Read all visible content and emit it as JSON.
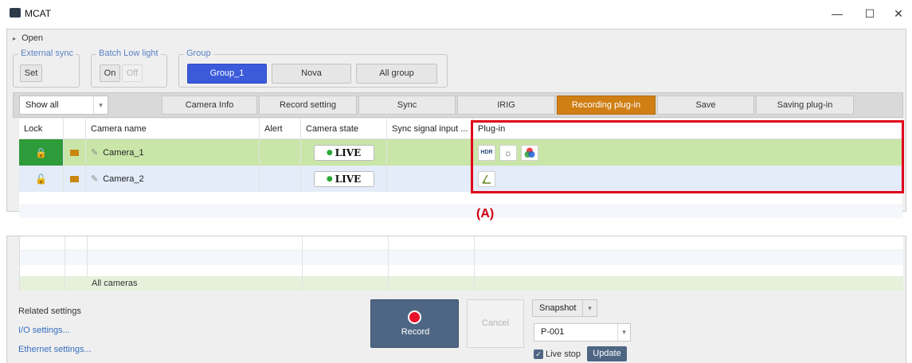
{
  "window": {
    "title": "MCAT",
    "minimize": "—",
    "maximize": "☐",
    "close": "✕"
  },
  "open_label": "Open",
  "groups": {
    "external_sync": {
      "legend": "External sync",
      "set": "Set"
    },
    "batch_low_light": {
      "legend": "Batch Low light",
      "on": "On",
      "off": "Off"
    },
    "group": {
      "legend": "Group",
      "items": [
        "Group_1",
        "Nova",
        "All group"
      ]
    }
  },
  "toolbar": {
    "filter": "Show all",
    "tabs": [
      "Camera Info",
      "Record setting",
      "Sync",
      "IRIG",
      "Recording plug-in",
      "Save",
      "Saving plug-in"
    ]
  },
  "table": {
    "headers": [
      "Lock",
      "Camera name",
      "Alert",
      "Camera state",
      "Sync signal input ...",
      "Plug-in"
    ],
    "rows": [
      {
        "name": "Camera_1",
        "state": "LIVE",
        "plugins": [
          "HDR",
          "light",
          "color"
        ]
      },
      {
        "name": "Camera_2",
        "state": "LIVE",
        "plugins": [
          "angle"
        ]
      }
    ],
    "footer": "All cameras"
  },
  "annotation": "(A)",
  "bottom": {
    "related_title": "Related settings",
    "io_link": "I/O settings...",
    "eth_link": "Ethernet settings...",
    "record": "Record",
    "cancel": "Cancel",
    "snapshot": "Snapshot",
    "preset": "P-001",
    "live_stop": "Live stop",
    "update": "Update"
  },
  "colors": {
    "accent": "#3b5bdb",
    "active_tab": "#cf7f14",
    "row_selected": "#c9e6a8",
    "row2": "#e3ecf8",
    "highlight": "#e0001a",
    "record": "#e8122c"
  }
}
